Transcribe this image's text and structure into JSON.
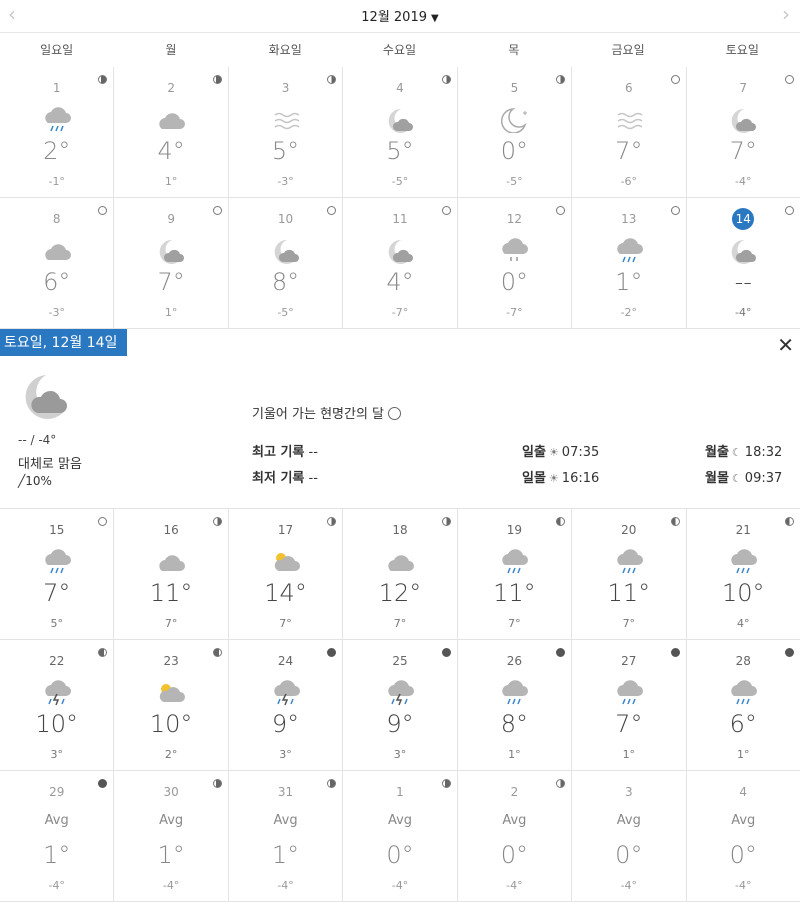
{
  "header": {
    "month_label": "12월 2019",
    "prev": "‹",
    "next": "›",
    "caret": "▼"
  },
  "weekdays": [
    "일요일",
    "월",
    "화요일",
    "수요일",
    "목",
    "금요일",
    "토요일"
  ],
  "weeks": [
    [
      {
        "day": "1",
        "hi": "2°",
        "lo": "-1°",
        "icon": "rain-cloud",
        "moon": "q-r",
        "past": true
      },
      {
        "day": "2",
        "hi": "4°",
        "lo": "1°",
        "icon": "cloud",
        "moon": "q-r",
        "past": true
      },
      {
        "day": "3",
        "hi": "5°",
        "lo": "-3°",
        "icon": "fog",
        "moon": "half-r",
        "past": true
      },
      {
        "day": "4",
        "hi": "5°",
        "lo": "-5°",
        "icon": "moon-cloud",
        "moon": "half-r",
        "past": true
      },
      {
        "day": "5",
        "hi": "0°",
        "lo": "-5°",
        "icon": "clear-night",
        "moon": "half-r",
        "past": true
      },
      {
        "day": "6",
        "hi": "7°",
        "lo": "-6°",
        "icon": "fog",
        "moon": "full",
        "past": true
      },
      {
        "day": "7",
        "hi": "7°",
        "lo": "-4°",
        "icon": "moon-cloud",
        "moon": "full",
        "past": true
      }
    ],
    [
      {
        "day": "8",
        "hi": "6°",
        "lo": "-3°",
        "icon": "cloud",
        "moon": "full",
        "past": true
      },
      {
        "day": "9",
        "hi": "7°",
        "lo": "1°",
        "icon": "moon-cloud",
        "moon": "full",
        "past": true
      },
      {
        "day": "10",
        "hi": "8°",
        "lo": "-5°",
        "icon": "moon-cloud",
        "moon": "full",
        "past": true
      },
      {
        "day": "11",
        "hi": "4°",
        "lo": "-7°",
        "icon": "moon-cloud",
        "moon": "full",
        "past": true
      },
      {
        "day": "12",
        "hi": "0°",
        "lo": "-7°",
        "icon": "cloud-drizzle",
        "moon": "full",
        "past": true
      },
      {
        "day": "13",
        "hi": "1°",
        "lo": "-2°",
        "icon": "rain-cloud",
        "moon": "full",
        "past": true
      },
      {
        "day": "14",
        "hi": "--",
        "lo": "-4°",
        "icon": "moon-cloud",
        "moon": "full",
        "past": false,
        "today": true
      }
    ]
  ],
  "detail": {
    "tab": "토요일, 12월 14일",
    "close": "✕",
    "hilo": "-- / -4°",
    "desc": "대체로 맑음",
    "precip": "10%",
    "moon_phase": "기울어 가는 현명간의 달",
    "rec_high_label": "최고 기록",
    "rec_high": "--",
    "rec_low_label": "최저 기록",
    "rec_low": "--",
    "sunrise_label": "일출",
    "sunrise": "07:35",
    "sunset_label": "일몰",
    "sunset": "16:16",
    "moonrise_label": "월출",
    "moonrise": "18:32",
    "moonset_label": "월몰",
    "moonset": "09:37"
  },
  "weeks2": [
    [
      {
        "day": "15",
        "hi": "7°",
        "lo": "5°",
        "icon": "rain-cloud",
        "moon": "full"
      },
      {
        "day": "16",
        "hi": "11°",
        "lo": "7°",
        "icon": "cloud",
        "moon": "half-r"
      },
      {
        "day": "17",
        "hi": "14°",
        "lo": "7°",
        "icon": "sun-cloud",
        "moon": "half-r"
      },
      {
        "day": "18",
        "hi": "12°",
        "lo": "7°",
        "icon": "cloud",
        "moon": "half-r"
      },
      {
        "day": "19",
        "hi": "11°",
        "lo": "7°",
        "icon": "rain-cloud",
        "moon": "half-l"
      },
      {
        "day": "20",
        "hi": "11°",
        "lo": "7°",
        "icon": "rain-cloud",
        "moon": "half-l"
      },
      {
        "day": "21",
        "hi": "10°",
        "lo": "4°",
        "icon": "rain-cloud",
        "moon": "half-l"
      }
    ],
    [
      {
        "day": "22",
        "hi": "10°",
        "lo": "3°",
        "icon": "storm",
        "moon": "q-l"
      },
      {
        "day": "23",
        "hi": "10°",
        "lo": "2°",
        "icon": "sun-cloud",
        "moon": "q-l"
      },
      {
        "day": "24",
        "hi": "9°",
        "lo": "3°",
        "icon": "storm",
        "moon": "new"
      },
      {
        "day": "25",
        "hi": "9°",
        "lo": "3°",
        "icon": "storm",
        "moon": "new"
      },
      {
        "day": "26",
        "hi": "8°",
        "lo": "1°",
        "icon": "rain-cloud",
        "moon": "new"
      },
      {
        "day": "27",
        "hi": "7°",
        "lo": "1°",
        "icon": "rain-cloud",
        "moon": "new"
      },
      {
        "day": "28",
        "hi": "6°",
        "lo": "1°",
        "icon": "rain-cloud",
        "moon": "new"
      }
    ],
    [
      {
        "day": "29",
        "hi": "1°",
        "lo": "-4°",
        "avg": "Avg",
        "moon": "new",
        "past": true
      },
      {
        "day": "30",
        "hi": "1°",
        "lo": "-4°",
        "avg": "Avg",
        "moon": "q-r",
        "past": true
      },
      {
        "day": "31",
        "hi": "1°",
        "lo": "-4°",
        "avg": "Avg",
        "moon": "q-r",
        "past": true
      },
      {
        "day": "1",
        "hi": "0°",
        "lo": "-4°",
        "avg": "Avg",
        "moon": "q-r",
        "past": true
      },
      {
        "day": "2",
        "hi": "0°",
        "lo": "-4°",
        "avg": "Avg",
        "moon": "half-r",
        "past": true
      },
      {
        "day": "3",
        "hi": "0°",
        "lo": "-4°",
        "avg": "Avg",
        "moon": "none",
        "past": true
      },
      {
        "day": "4",
        "hi": "0°",
        "lo": "-4°",
        "avg": "Avg",
        "moon": "none",
        "past": true
      }
    ]
  ]
}
